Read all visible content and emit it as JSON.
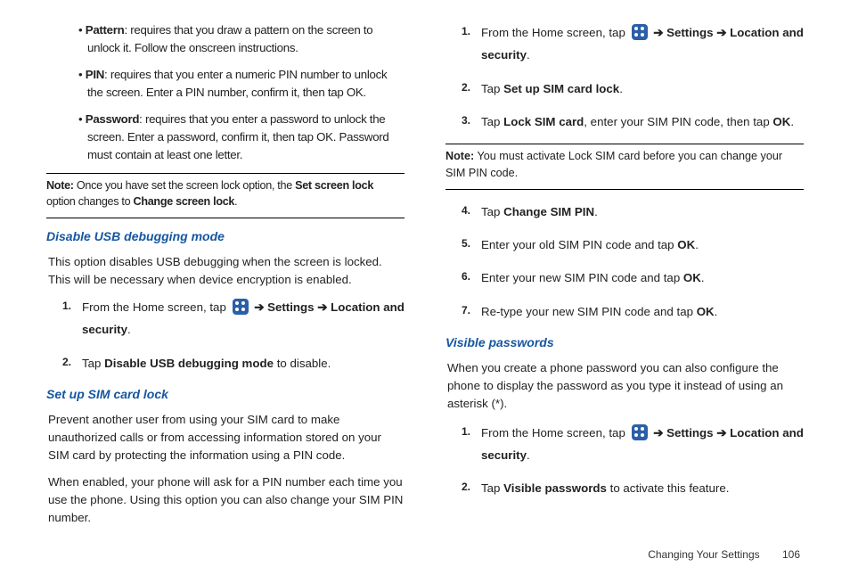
{
  "left": {
    "bullets": [
      {
        "label": "Pattern",
        "text": ": requires that you draw a pattern on the screen to unlock it. Follow the onscreen instructions."
      },
      {
        "label": "PIN",
        "text": ": requires that you enter a numeric PIN number to unlock the screen. Enter a PIN number, confirm it, then tap OK."
      },
      {
        "label": "Password",
        "text": ": requires that you enter a password to unlock the screen. Enter a password, confirm it, then tap OK. Password must contain at least one letter."
      }
    ],
    "note": {
      "label": "Note:",
      "pre": "Once you have set the screen lock option, the ",
      "bold1": "Set screen lock",
      "mid": " option changes to ",
      "bold2": "Change screen lock",
      "post": "."
    },
    "h1": "Disable USB debugging mode",
    "p1": "This option disables USB debugging when the screen is locked. This will be necessary when device encryption is enabled.",
    "s1": {
      "pre": "From the Home screen, tap ",
      "arrow1": "➔",
      "b1": "Settings",
      "arrow2": "➔",
      "b2": "Location and security",
      "post": "."
    },
    "s2": {
      "pre": "Tap ",
      "b": "Disable USB debugging mode",
      "post": " to disable."
    },
    "h2": "Set up SIM card lock",
    "p2": "Prevent another user from using your SIM card to make unauthorized calls or from accessing information stored on your SIM card by protecting the information using a PIN code.",
    "p3": "When enabled, your phone will ask for a PIN number each time you use the phone. Using this option you can also change your SIM PIN number."
  },
  "right": {
    "s1": {
      "pre": "From the Home screen, tap ",
      "arrow1": "➔",
      "b1": "Settings",
      "arrow2": "➔",
      "b2": "Location and security",
      "post": "."
    },
    "s2": {
      "pre": "Tap ",
      "b": "Set up SIM card lock",
      "post": "."
    },
    "s3": {
      "pre": "Tap ",
      "b1": "Lock SIM card",
      "mid": ", enter your SIM PIN code, then tap ",
      "b2": "OK",
      "post": "."
    },
    "note": {
      "label": "Note:",
      "text": "You must activate Lock SIM card before you can change your SIM PIN code."
    },
    "s4": {
      "pre": "Tap ",
      "b": "Change SIM PIN",
      "post": "."
    },
    "s5": {
      "pre": "Enter your old SIM PIN code and tap ",
      "b": "OK",
      "post": "."
    },
    "s6": {
      "pre": "Enter your new SIM PIN code and tap ",
      "b": "OK",
      "post": "."
    },
    "s7": {
      "pre": "Re-type your new SIM PIN code and tap ",
      "b": "OK",
      "post": "."
    },
    "h1": "Visible passwords",
    "p1": "When you create a phone password you can also configure the phone to display the password as you type it instead of using an asterisk (*).",
    "vs1": {
      "pre": "From the Home screen, tap ",
      "arrow1": "➔",
      "b1": "Settings",
      "arrow2": "➔",
      "b2": "Location and security",
      "post": "."
    },
    "vs2": {
      "pre": "Tap ",
      "b": "Visible passwords",
      "post": " to activate this feature."
    }
  },
  "footer": {
    "section": "Changing Your Settings",
    "page": "106"
  },
  "nums": {
    "n1": "1.",
    "n2": "2.",
    "n3": "3.",
    "n4": "4.",
    "n5": "5.",
    "n6": "6.",
    "n7": "7."
  }
}
